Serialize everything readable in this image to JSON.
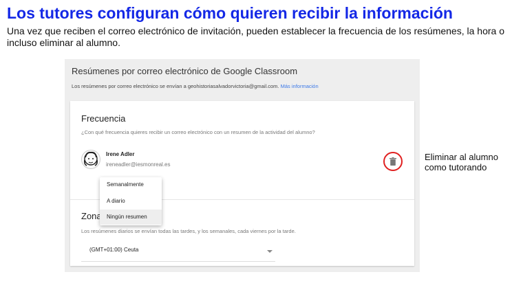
{
  "slide": {
    "title": "Los tutores configuran cómo quieren recibir la información",
    "subtitle": "Una vez que reciben el correo electrónico de invitación, pueden establecer la frecuencia de los resúmenes, la hora o incluso eliminar al alumno."
  },
  "panel": {
    "title": "Resúmenes por correo electrónico de Google Classroom",
    "subtitle": "Los resúmenes por correo electrónico se envían a geohistoriasalvadorvictoria@gmail.com.",
    "link": "Más información"
  },
  "frequency": {
    "title": "Frecuencia",
    "question": "¿Con qué frecuencia quieres recibir un correo electrónico con un resumen de la actividad del alumno?"
  },
  "student": {
    "name": "Irene Adler",
    "email": "ireneadler@iesmonreal.es"
  },
  "dropdown": {
    "options": [
      "Semanalmente",
      "A diario",
      "Ningún resumen"
    ],
    "selected": "Ningún resumen"
  },
  "timezone": {
    "title": "Zona",
    "description": "Los resúmenes diarios se envían todas las tardes, y los semanales, cada viernes por la tarde.",
    "value": "(GMT+01:00) Ceuta"
  },
  "annotation": {
    "text": "Eliminar al alumno como tutorando"
  },
  "colors": {
    "title": "#1428e6",
    "link": "#3b78e7",
    "highlight_ring": "#e02020"
  },
  "icons": [
    "trash-icon",
    "dropdown-caret-icon",
    "avatar-sketch"
  ]
}
